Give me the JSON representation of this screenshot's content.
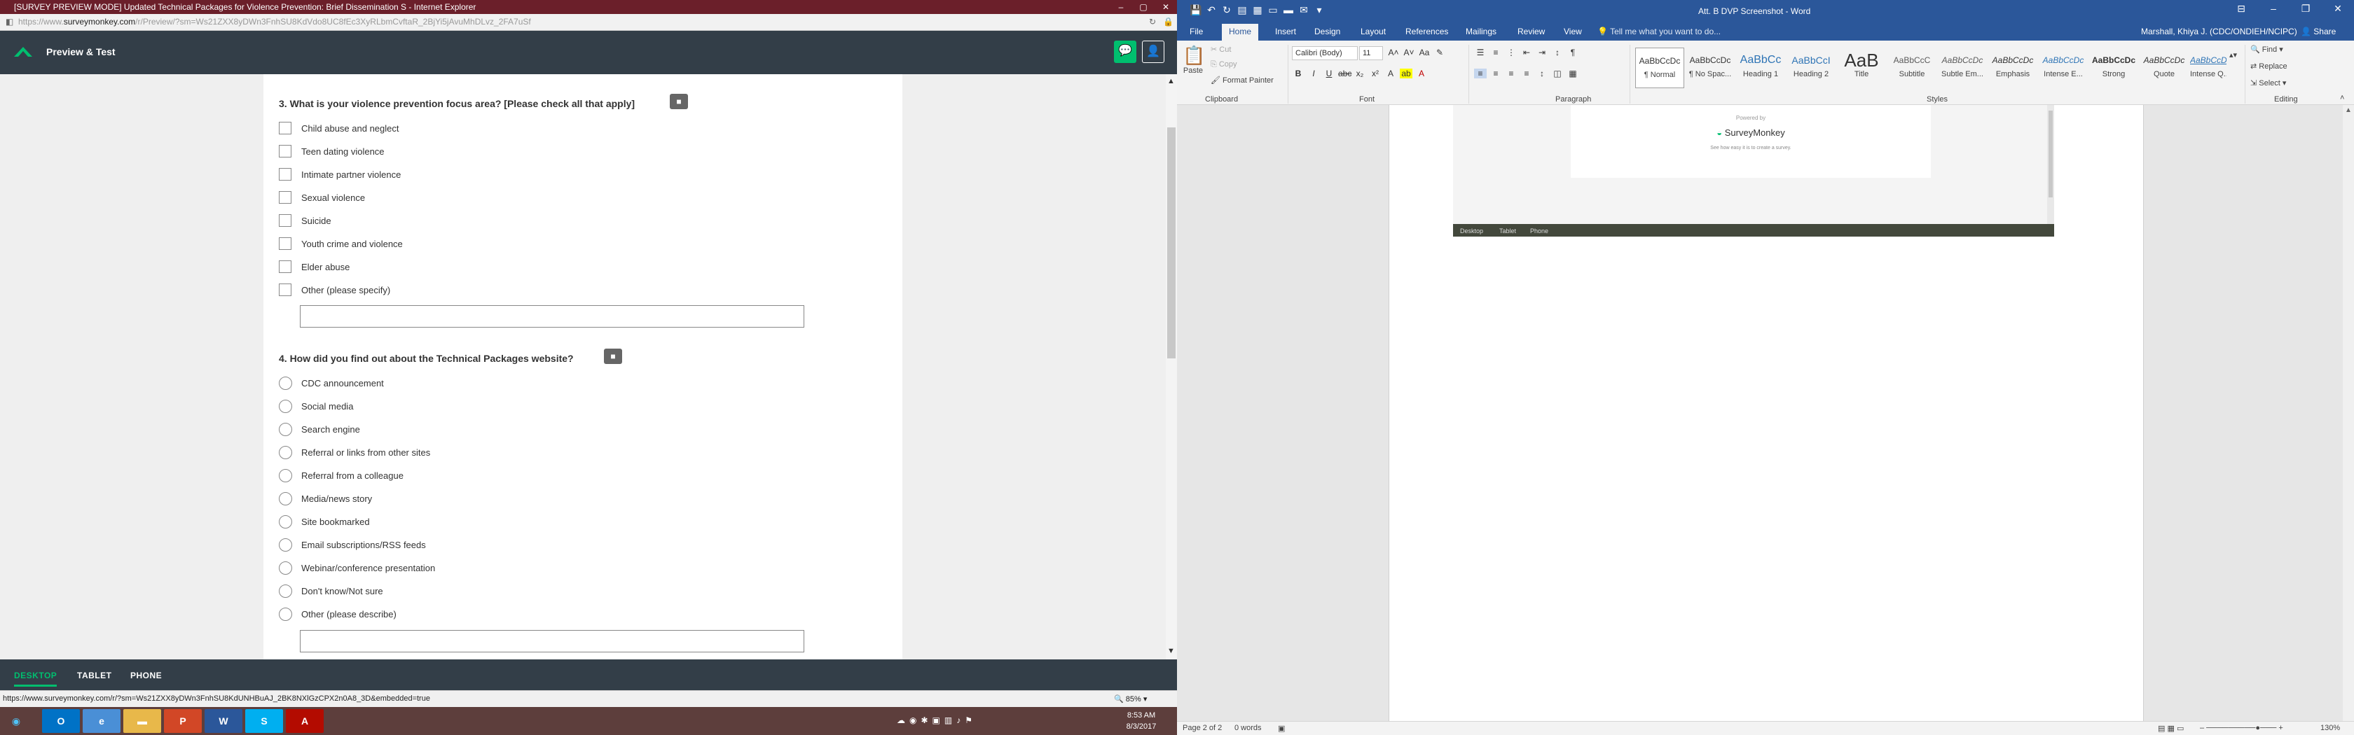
{
  "ie": {
    "title": "[SURVEY PREVIEW MODE] Updated Technical Packages for Violence Prevention: Brief Dissemination S - Internet Explorer",
    "url_host_prefix": "https://www.",
    "url_host": "surveymonkey.com",
    "url_path": "/r/Preview/?sm=Ws21ZXX8yDWn3FnhSU8KdVdo8UC8fEc3XyRLbmCvftaR_2BjYi5jAvuMhDLvz_2FA7uSf",
    "preview_title": "Preview & Test",
    "status_url": "https://www.surveymonkey.com/r/?sm=Ws21ZXX8yDWn3FnhSU8KdUNHBuAJ_2BK8NXlGzCPX2n0A8_3D&embedded=true",
    "zoom": "85%",
    "footer_tabs": [
      "DESKTOP",
      "TABLET",
      "PHONE"
    ]
  },
  "survey": {
    "q3": {
      "title": "3. What is your violence prevention focus area? [Please check all that apply]",
      "options": [
        "Child abuse and neglect",
        "Teen dating violence",
        "Intimate partner violence",
        "Sexual violence",
        "Suicide",
        "Youth crime and violence",
        "Elder abuse",
        "Other (please specify)"
      ]
    },
    "q4": {
      "title": "4. How did you find out about the Technical Packages website?",
      "options": [
        "CDC announcement",
        "Social media",
        "Search engine",
        "Referral or links from other sites",
        "Referral from a colleague",
        "Media/news story",
        "Site bookmarked",
        "Email subscriptions/RSS feeds",
        "Webinar/conference presentation",
        "Don't know/Not sure",
        "Other (please describe)"
      ]
    }
  },
  "word": {
    "title": "Att. B DVP Screenshot - Word",
    "tabs": [
      "File",
      "Home",
      "Insert",
      "Design",
      "Layout",
      "References",
      "Mailings",
      "Review",
      "View"
    ],
    "tell_me": "Tell me what you want to do...",
    "user": "Marshall, Khiya J. (CDC/ONDIEH/NCIPC)",
    "share": "Share",
    "clipboard": {
      "paste": "Paste",
      "cut": "Cut",
      "copy": "Copy",
      "format_painter": "Format Painter",
      "label": "Clipboard"
    },
    "font": {
      "name": "Calibri (Body)",
      "size": "11",
      "label": "Font"
    },
    "paragraph_label": "Paragraph",
    "styles_label": "Styles",
    "styles": [
      {
        "sample": "AaBbCcDc",
        "name": "¶ Normal"
      },
      {
        "sample": "AaBbCcDc",
        "name": "¶ No Spac..."
      },
      {
        "sample": "AaBbCc",
        "name": "Heading 1"
      },
      {
        "sample": "AaBbCcI",
        "name": "Heading 2"
      },
      {
        "sample": "AaB",
        "name": "Title"
      },
      {
        "sample": "AaBbCcC",
        "name": "Subtitle"
      },
      {
        "sample": "AaBbCcDc",
        "name": "Subtle Em..."
      },
      {
        "sample": "AaBbCcDc",
        "name": "Emphasis"
      },
      {
        "sample": "AaBbCcDc",
        "name": "Intense E..."
      },
      {
        "sample": "AaBbCcDc",
        "name": "Strong"
      },
      {
        "sample": "AaBbCcDc",
        "name": "Quote"
      },
      {
        "sample": "AaBbCcDc",
        "name": "Intense Q..."
      }
    ],
    "editing": {
      "find": "Find",
      "replace": "Replace",
      "select": "Select",
      "label": "Editing"
    },
    "embedded": {
      "powered_by": "Powered by",
      "brand": "SurveyMonkey",
      "tagline": "See how easy it is to create a survey.",
      "tabs": [
        "Desktop",
        "Tablet",
        "Phone"
      ]
    },
    "status": {
      "page": "Page 2 of 2",
      "words": "0 words",
      "zoom": "130%"
    }
  },
  "taskbar": {
    "time": "8:53 AM",
    "date": "8/3/2017"
  },
  "colors": {
    "ie_title": "#6b1f2a",
    "sm_header": "#333e48",
    "sm_green": "#00bf6f",
    "word_blue": "#2b579a",
    "taskbar": "#5d3e3c"
  }
}
